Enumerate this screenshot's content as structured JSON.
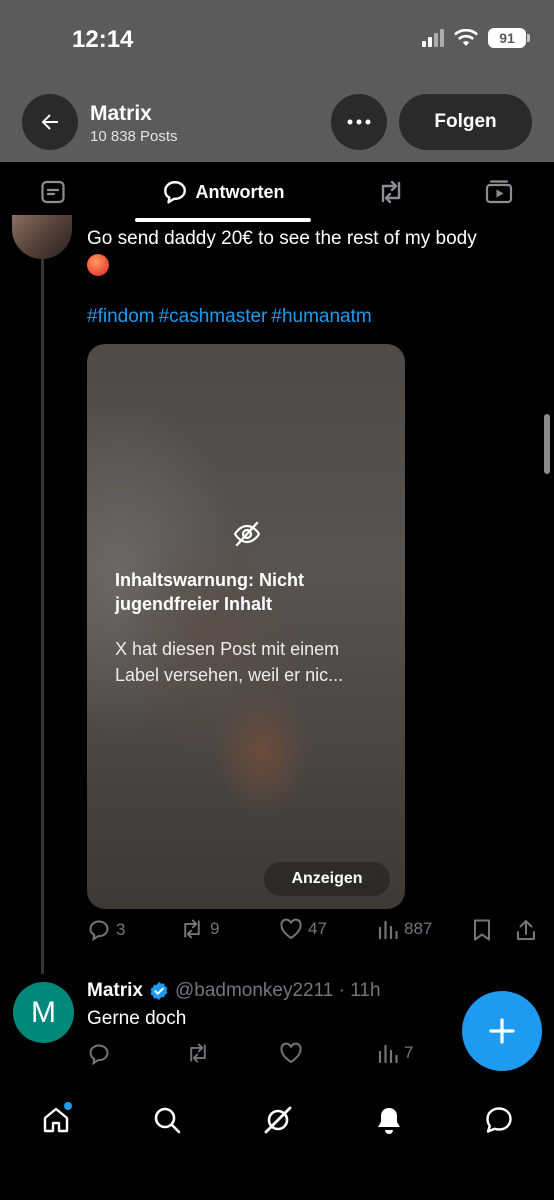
{
  "status_bar": {
    "time": "12:14",
    "battery": "91"
  },
  "header": {
    "name": "Matrix",
    "posts": "10 838 Posts",
    "follow_label": "Folgen"
  },
  "tabs": {
    "active_label": "Antworten"
  },
  "post": {
    "text": "Go send daddy 20€ to see the rest of my body",
    "hashtags": [
      "#findom",
      "#cashmaster",
      "#humanatm"
    ],
    "content_warning": {
      "title": "Inhaltswarnung: Nicht jugendfreier Inhalt",
      "text": "X hat diesen Post mit einem Label versehen, weil er nic...",
      "button_label": "Anzeigen"
    },
    "stats": {
      "replies": "3",
      "reposts": "9",
      "likes": "47",
      "views": "887"
    }
  },
  "reply": {
    "avatar_letter": "M",
    "name": "Matrix",
    "handle_time": "@badmonkey2211 · 11h",
    "text": "Gerne doch",
    "stats": {
      "views": "7"
    }
  },
  "colors": {
    "accent": "#1d9bf0",
    "avatar_m": "#00897b",
    "header_bg": "#5b5b5b"
  },
  "icons": [
    "back-arrow-icon",
    "more-icon",
    "posts-tab-icon",
    "reply-bubble-icon",
    "repost-icon",
    "media-tab-icon",
    "eye-off-icon",
    "like-icon",
    "views-icon",
    "bookmark-icon",
    "share-icon",
    "verified-icon",
    "grok-icon",
    "home-icon",
    "search-icon",
    "bell-icon",
    "messages-icon",
    "plus-icon"
  ]
}
